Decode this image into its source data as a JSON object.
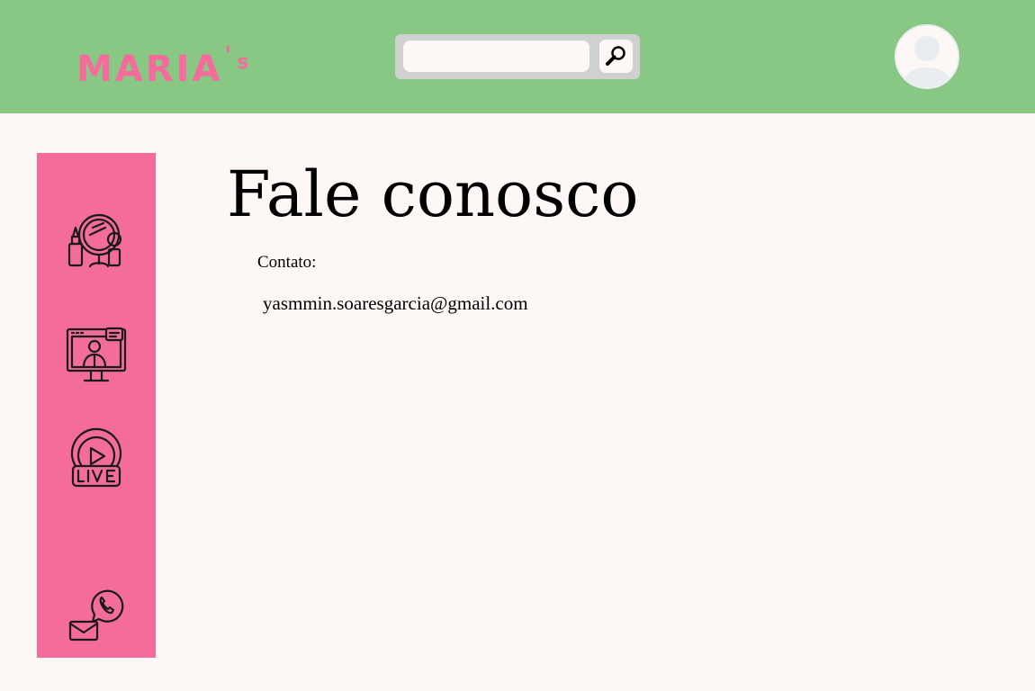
{
  "header": {
    "logo": {
      "text": "MARIA",
      "apostrophe": "'",
      "suffix": "s"
    },
    "search": {
      "value": "",
      "placeholder": "",
      "button_icon": "search-icon"
    },
    "avatar_icon": "user-avatar-icon",
    "background_color": "#89c785"
  },
  "sidebar": {
    "background_color": "#f46c9c",
    "items": [
      {
        "icon": "makeup-mirror-icon"
      },
      {
        "icon": "video-tutorial-icon"
      },
      {
        "icon": "live-stream-icon"
      },
      {
        "icon": "whatsapp-mail-contact-icon"
      }
    ]
  },
  "main": {
    "title": "Fale conosco",
    "contact_label": "Contato:",
    "email": "yasmmin.soaresgarcia@gmail.com"
  },
  "colors": {
    "accent_pink": "#f46c9c",
    "header_green": "#89c785",
    "page_background": "#fdf8f6"
  }
}
